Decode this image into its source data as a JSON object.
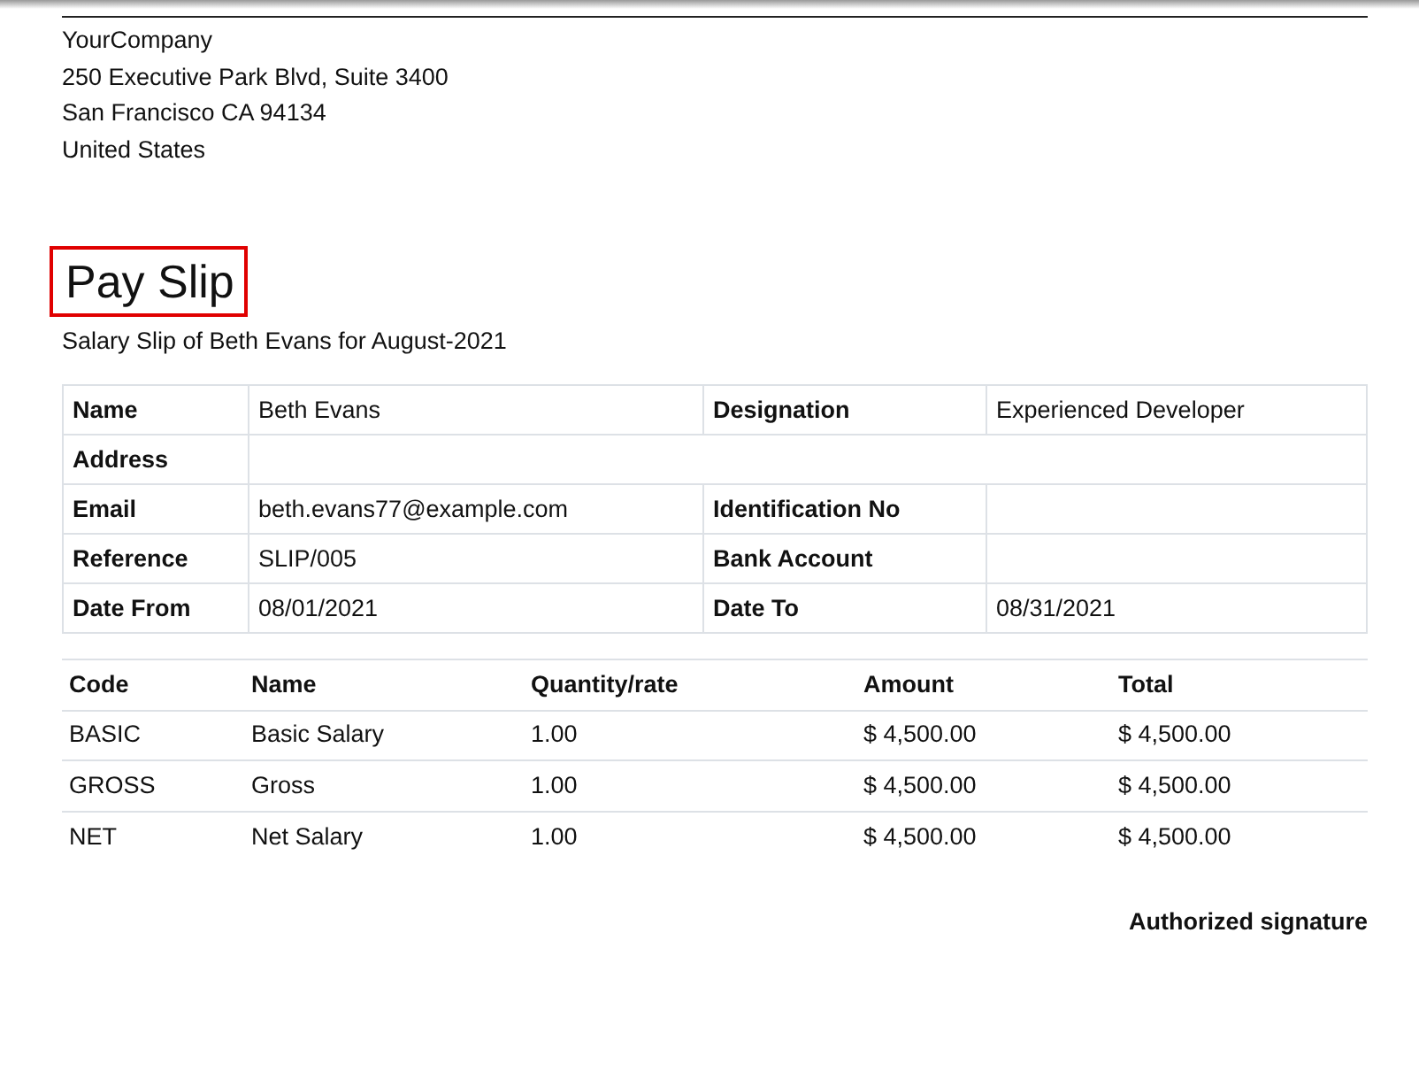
{
  "company": {
    "lines": [
      "YourCompany",
      "250 Executive Park Blvd, Suite 3400",
      "San Francisco CA 94134",
      "United States"
    ]
  },
  "title": {
    "text": "Pay Slip",
    "highlighted": true
  },
  "subtitle": "Salary Slip of Beth Evans for August-2021",
  "details": [
    [
      {
        "label": "Name",
        "value": "Beth Evans"
      },
      {
        "label": "Designation",
        "value": "Experienced Developer"
      }
    ],
    [
      {
        "label": "Address"
      }
    ],
    [
      {
        "label": "Email",
        "value": "beth.evans77@example.com"
      },
      {
        "label": "Identification No"
      }
    ],
    [
      {
        "label": "Reference",
        "value": "SLIP/005"
      },
      {
        "label": "Bank Account"
      }
    ],
    [
      {
        "label": "Date From",
        "value": "08/01/2021"
      },
      {
        "label": "Date To",
        "value": "08/31/2021"
      }
    ]
  ],
  "lines_table": {
    "columns": [
      "Code",
      "Name",
      "Quantity/rate",
      "Amount",
      "Total"
    ],
    "rows": [
      [
        "BASIC",
        "Basic Salary",
        "1.00",
        "$ 4,500.00",
        "$ 4,500.00"
      ],
      [
        "GROSS",
        "Gross",
        "1.00",
        "$ 4,500.00",
        "$ 4,500.00"
      ],
      [
        "NET",
        "Net Salary",
        "1.00",
        "$ 4,500.00",
        "$ 4,500.00"
      ]
    ]
  },
  "signature": "Authorized signature"
}
